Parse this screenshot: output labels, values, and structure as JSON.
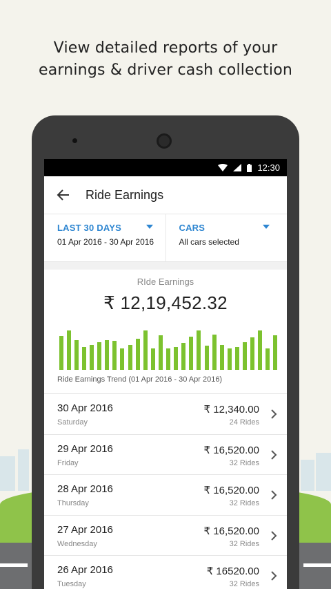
{
  "headline": {
    "line1": "View detailed reports of your",
    "line2": "earnings & driver cash collection"
  },
  "statusbar": {
    "time": "12:30",
    "icons": [
      "wifi-icon",
      "signal-icon",
      "battery-icon"
    ]
  },
  "appbar": {
    "title": "Ride Earnings",
    "back_icon": "arrow-left-icon"
  },
  "filters": {
    "date": {
      "label": "LAST 30 DAYS",
      "value": "01 Apr 2016 - 30 Apr 2016"
    },
    "cars": {
      "label": "CARS",
      "value": "All cars selected"
    }
  },
  "summary": {
    "label": "RIde Earnings",
    "total": "₹ 12,19,452.32",
    "trend_label": "Ride Earnings Trend  (01 Apr 2016 - 30 Apr 2016)"
  },
  "chart_data": {
    "type": "bar",
    "values": [
      0.82,
      0.95,
      0.72,
      0.55,
      0.6,
      0.67,
      0.72,
      0.7,
      0.52,
      0.6,
      0.75,
      0.95,
      0.52,
      0.83,
      0.52,
      0.55,
      0.65,
      0.8,
      0.95,
      0.58,
      0.85,
      0.6,
      0.52,
      0.55,
      0.67,
      0.78,
      0.95,
      0.52,
      0.84
    ],
    "color": "#7cc22f"
  },
  "rows": [
    {
      "date": "30 Apr 2016",
      "day": "Saturday",
      "amount": "₹ 12,340.00",
      "rides": "24 Rides"
    },
    {
      "date": "29 Apr 2016",
      "day": "Friday",
      "amount": "₹ 16,520.00",
      "rides": "32 Rides"
    },
    {
      "date": "28 Apr 2016",
      "day": "Thursday",
      "amount": "₹ 16,520.00",
      "rides": "32 Rides"
    },
    {
      "date": "27 Apr 2016",
      "day": "Wednesday",
      "amount": "₹ 16,520.00",
      "rides": "32 Rides"
    },
    {
      "date": "26 Apr 2016",
      "day": "Tuesday",
      "amount": "₹ 16520.00",
      "rides": "32 Rides"
    }
  ],
  "colors": {
    "accent": "#2e86d1",
    "bar": "#7cc22f",
    "grass": "#8fc34a",
    "road": "#6d6e70"
  }
}
